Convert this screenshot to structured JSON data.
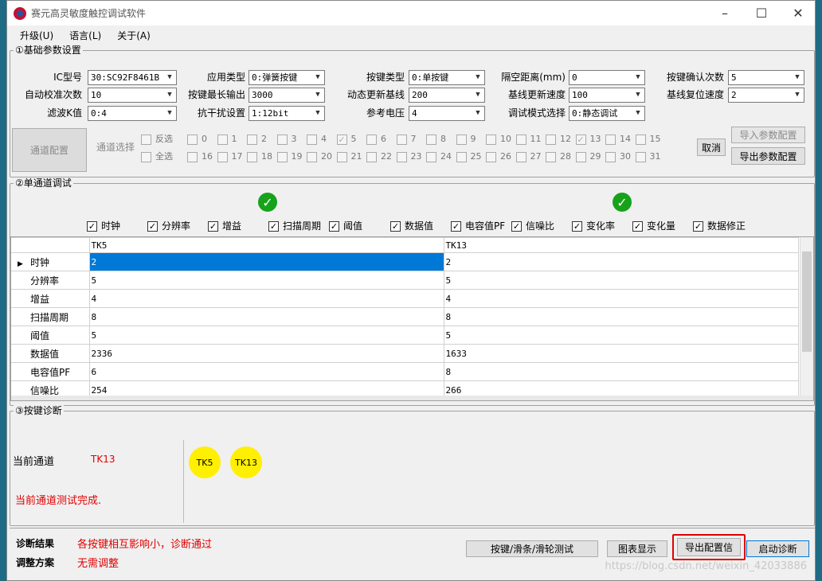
{
  "window": {
    "title": "赛元高灵敏度触控调试软件"
  },
  "menu": [
    "升级(U)",
    "语言(L)",
    "关于(A)"
  ],
  "basic": {
    "title": "①基础参数设置",
    "fields": [
      {
        "label": "IC型号",
        "value": "30:SC92F8461B"
      },
      {
        "label": "应用类型",
        "value": "0:弹簧按键"
      },
      {
        "label": "按键类型",
        "value": "0:单按键"
      },
      {
        "label": "隔空距离(mm)",
        "value": "0"
      },
      {
        "label": "按键确认次数",
        "value": "5"
      },
      {
        "label": "自动校准次数",
        "value": "10"
      },
      {
        "label": "按键最长输出",
        "value": "3000"
      },
      {
        "label": "动态更新基线",
        "value": "200"
      },
      {
        "label": "基线更新速度",
        "value": "100"
      },
      {
        "label": "基线复位速度",
        "value": "2"
      },
      {
        "label": "滤波K值",
        "value": "0:4"
      },
      {
        "label": "抗干扰设置",
        "value": "1:12bit"
      },
      {
        "label": "参考电压",
        "value": "4"
      },
      {
        "label": "调试模式选择",
        "value": "0:静态调试"
      }
    ],
    "channel_config": "通道配置",
    "channel_select": "通道选择",
    "invert": "反选",
    "select_all": "全选",
    "channels_row1": [
      "0",
      "1",
      "2",
      "3",
      "4",
      "5",
      "6",
      "7",
      "8",
      "9",
      "10",
      "11",
      "12",
      "13",
      "14",
      "15"
    ],
    "channels_row2": [
      "16",
      "17",
      "18",
      "19",
      "20",
      "21",
      "22",
      "23",
      "24",
      "25",
      "26",
      "27",
      "28",
      "29",
      "30",
      "31"
    ],
    "checked_channels": [
      "5",
      "13"
    ],
    "cancel": "取消",
    "import": "导入参数配置",
    "export": "导出参数配置"
  },
  "single": {
    "title": "②单通道调试",
    "options": [
      "时钟",
      "分辨率",
      "增益",
      "扫描周期",
      "阈值",
      "数据值",
      "电容值PF",
      "信噪比",
      "变化率",
      "变化量",
      "数据修正"
    ],
    "columns": [
      "TK5",
      "TK13"
    ],
    "rows": [
      {
        "name": "时钟",
        "v1": "2",
        "v2": "2"
      },
      {
        "name": "分辨率",
        "v1": "5",
        "v2": "5"
      },
      {
        "name": "增益",
        "v1": "4",
        "v2": "4"
      },
      {
        "name": "扫描周期",
        "v1": "8",
        "v2": "8"
      },
      {
        "name": "阈值",
        "v1": "5",
        "v2": "5"
      },
      {
        "name": "数据值",
        "v1": "2336",
        "v2": "1633"
      },
      {
        "name": "电容值PF",
        "v1": "6",
        "v2": "8"
      },
      {
        "name": "信噪比",
        "v1": "254",
        "v2": "266"
      }
    ]
  },
  "diag": {
    "title": "③按键诊断",
    "current_label": "当前通道",
    "current_value": "TK13",
    "status": "当前通道测试完成.",
    "keys": [
      "TK5",
      "TK13"
    ],
    "result_label": "诊断结果",
    "result_value": "各按键相互影响小，诊断通过",
    "adjust_label": "调整方案",
    "adjust_value": "无需调整",
    "btn_slider": "按键/滑条/滑轮测试",
    "btn_chart": "图表显示",
    "btn_export": "导出配置信",
    "btn_start": "启动诊断"
  },
  "watermark": "https://blog.csdn.net/weixin_42033886",
  "colors": {
    "selection": "#0078d7",
    "alert": "#e00000",
    "key": "#ffef00",
    "ok": "#16a21a"
  }
}
